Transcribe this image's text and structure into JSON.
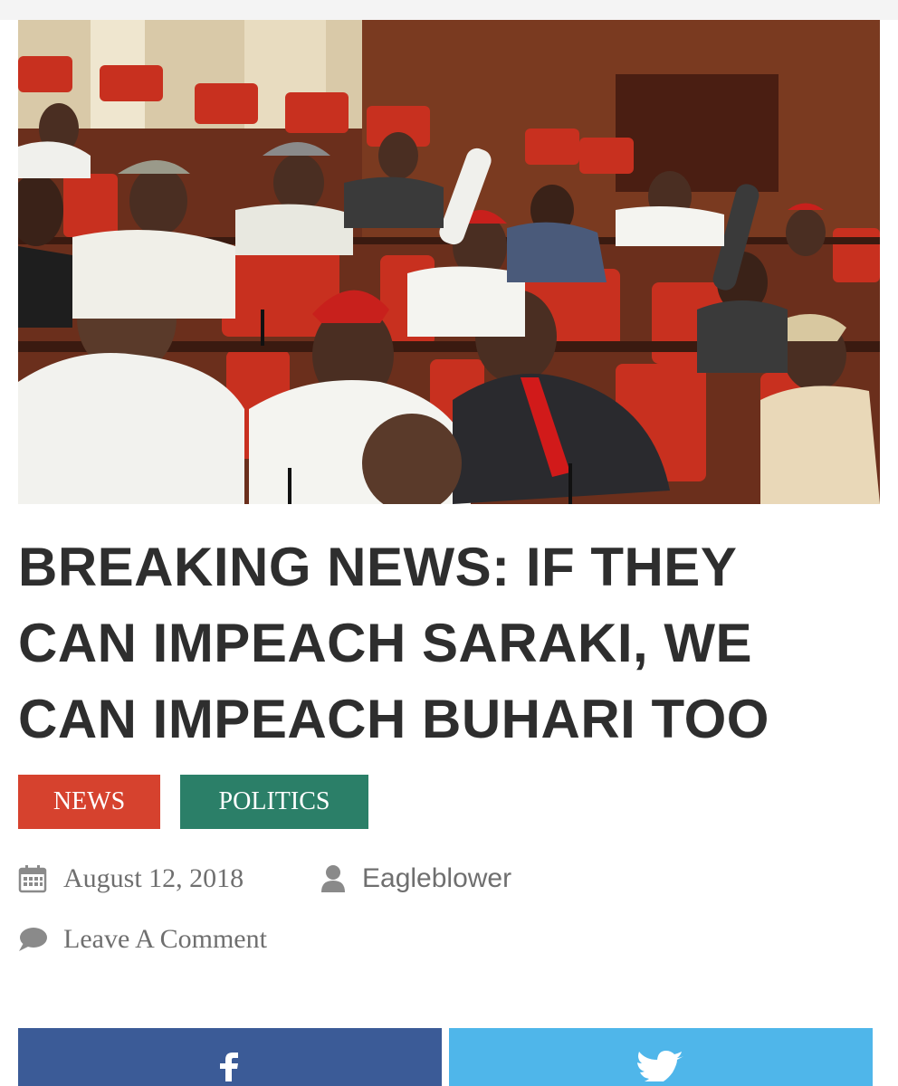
{
  "article": {
    "title": "BREAKING NEWS: IF THEY CAN IMPEACH SARAKI, WE CAN IMPEACH BUHARI TOO",
    "categories": [
      {
        "label": "NEWS",
        "color": "#d6422e"
      },
      {
        "label": "POLITICS",
        "color": "#2b7f68"
      }
    ],
    "date": "August 12, 2018",
    "author": "Eagleblower",
    "comment_link": "Leave A Comment"
  },
  "hero_image": {
    "subject": "legislators seated in red chamber seats, some raising hands to vote"
  },
  "share": {
    "facebook_color": "#3b5b97",
    "twitter_color": "#4fb6ea",
    "icons": [
      "facebook-icon",
      "twitter-icon"
    ]
  },
  "icons": {
    "date": "calendar-icon",
    "author": "user-icon",
    "comment": "comment-icon"
  }
}
